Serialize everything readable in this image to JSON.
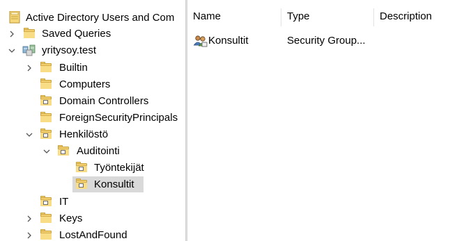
{
  "tree": {
    "root_label": "Active Directory Users and Com",
    "items": [
      {
        "label": "Saved Queries"
      },
      {
        "label": "yritysoy.test"
      },
      {
        "label": "Builtin"
      },
      {
        "label": "Computers"
      },
      {
        "label": "Domain Controllers"
      },
      {
        "label": "ForeignSecurityPrincipals"
      },
      {
        "label": "Henkilöstö"
      },
      {
        "label": "Auditointi"
      },
      {
        "label": "Työntekijät"
      },
      {
        "label": "Konsultit"
      },
      {
        "label": "IT"
      },
      {
        "label": "Keys"
      },
      {
        "label": "LostAndFound"
      }
    ],
    "selected": "Konsultit"
  },
  "list": {
    "columns": [
      {
        "label": "Name"
      },
      {
        "label": "Type"
      },
      {
        "label": "Description"
      }
    ],
    "rows": [
      {
        "name": "Konsultit",
        "type": "Security Group...",
        "description": "",
        "icon": "group-icon"
      }
    ]
  },
  "colors": {
    "folder": "#f3cf6f",
    "selection": "#d9d9d9",
    "divider": "#e4e4e4"
  }
}
